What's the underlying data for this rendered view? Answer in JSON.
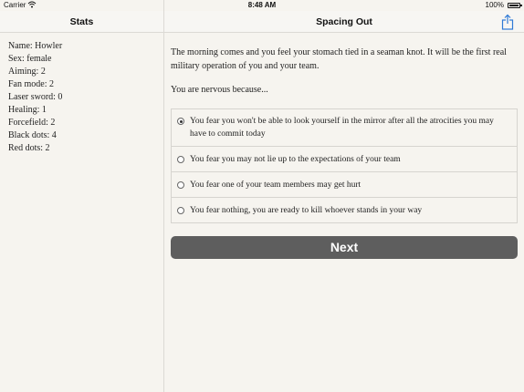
{
  "status_bar": {
    "carrier": "Carrier",
    "time": "8:48 AM",
    "battery": "100%"
  },
  "sidebar": {
    "title": "Stats",
    "stats": [
      "Name: Howler",
      "Sex: female",
      "Aiming: 2",
      "Fan mode: 2",
      "Laser sword: 0",
      "Healing: 1",
      "Forcefield: 2",
      "Black dots: 4",
      "Red dots: 2"
    ]
  },
  "main": {
    "title": "Spacing Out",
    "story": "The morning comes and you feel your stomach tied in a seaman knot. It will be the first real military operation of you and your team.",
    "question": "You are nervous because...",
    "options": [
      {
        "label": "You fear you won't be able to look yourself in the mirror after all the atrocities you may have to commit today",
        "selected": true
      },
      {
        "label": "You fear you may not lie up to the expectations of your team",
        "selected": false
      },
      {
        "label": "You fear one of your team members may get hurt",
        "selected": false
      },
      {
        "label": "You fear nothing, you are ready to kill whoever stands in your way",
        "selected": false
      }
    ],
    "next_label": "Next"
  },
  "icons": {
    "share": "share-icon",
    "wifi": "wifi-icon",
    "battery": "battery-icon"
  },
  "colors": {
    "background": "#f6f4ef",
    "button": "#5e5e5e",
    "accent": "#2f7ad6"
  }
}
